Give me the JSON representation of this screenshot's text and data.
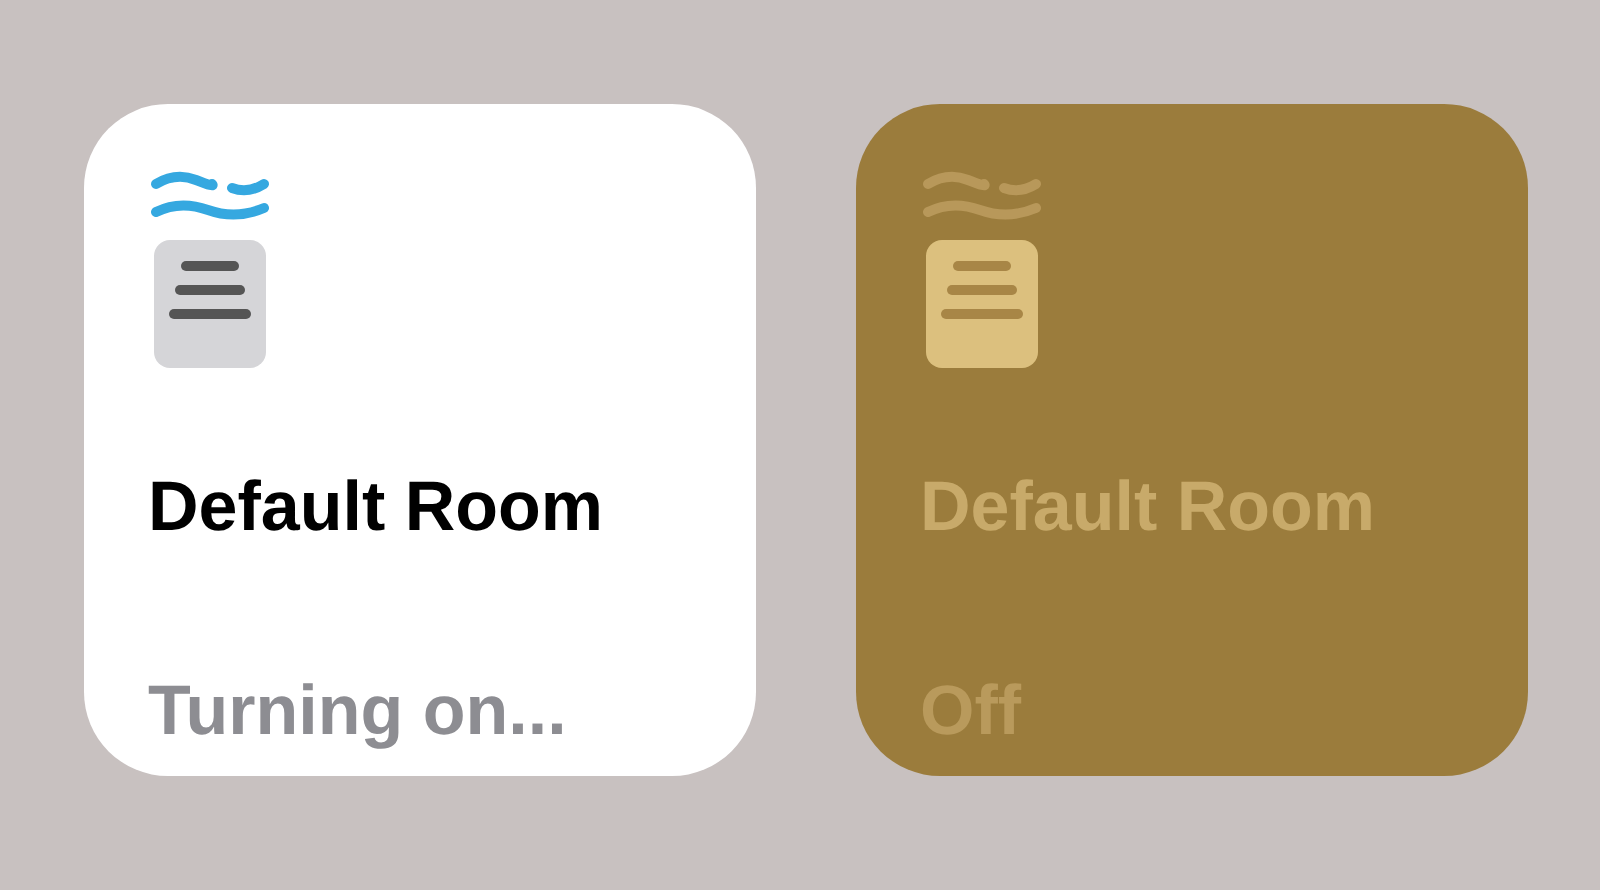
{
  "tiles": [
    {
      "name": "Default Room",
      "status": "Turning on...",
      "on": true
    },
    {
      "name": "Default Room",
      "status": "Off",
      "on": false
    }
  ]
}
